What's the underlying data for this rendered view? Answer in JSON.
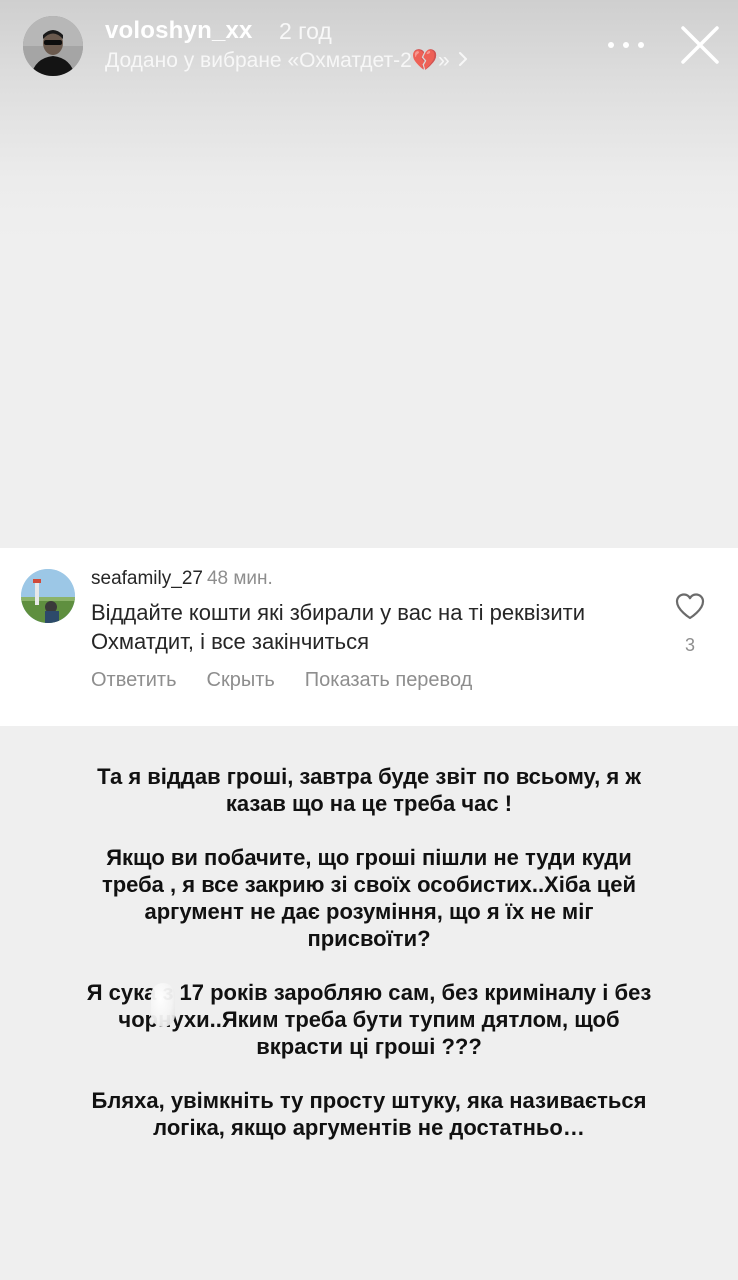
{
  "story": {
    "username": "voloshyn_xx",
    "time": "2 год",
    "favorites_label": "Додано у вибране «Охматдет-2💔»"
  },
  "comment": {
    "username": "seafamily_27",
    "time": "48 мин.",
    "text": "Віддайте кошти які збирали у вас на ті реквізити Охматдит, і все закінчиться",
    "actions": {
      "reply": "Ответить",
      "hide": "Скрыть",
      "translate": "Показать перевод"
    },
    "likes": "3"
  },
  "body": {
    "paragraphs": [
      "Та я віддав гроші, завтра буде звіт по всьому, я ж казав що на це треба час !",
      "Якщо ви побачите, що гроші пішли не туди куди треба , я все закрию зі своїх особистих..Хіба цей аргумент не дає розуміння, що я їх не міг присвоїти?",
      "Я сука з 17 років заробляю сам, без криміналу і без чорнухи..Яким треба бути тупим дятлом, щоб вкрасти ці гроші ???",
      "Бляха, увімкніть ту просту штуку, яка називається логіка, якщо аргументів не достатньо…"
    ]
  },
  "icons": {
    "more": "more-dots-icon",
    "close": "close-icon",
    "heart": "heart-outline-icon",
    "chevron": "chevron-right-icon"
  },
  "colors": {
    "background": "#efefef",
    "comment_card": "#ffffff",
    "secondary_text": "#8e8e8e"
  }
}
